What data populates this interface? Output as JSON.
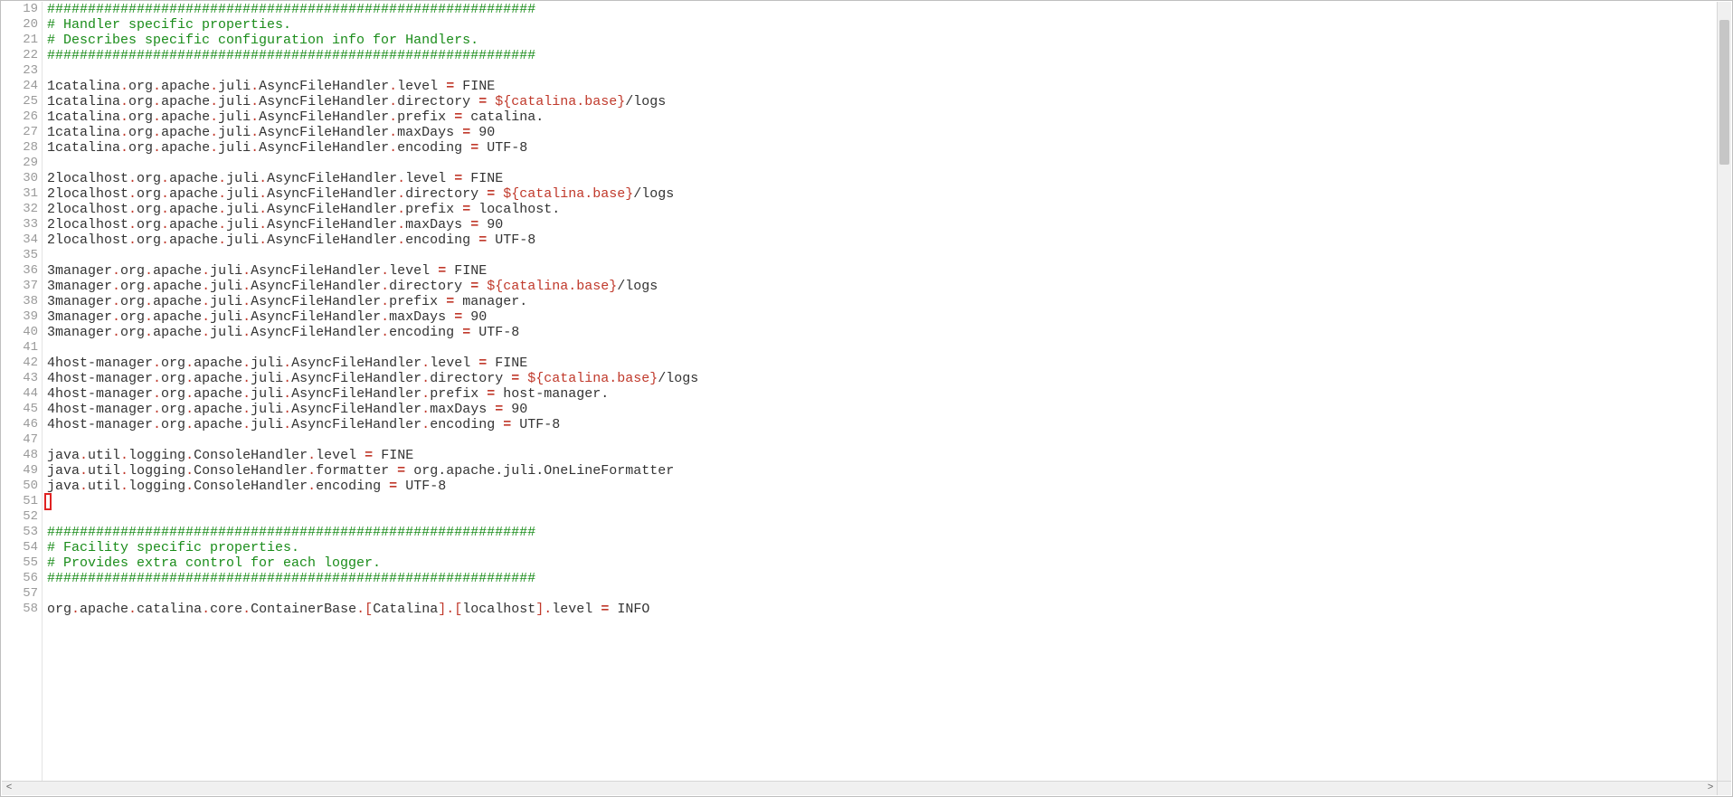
{
  "editor": {
    "first_line_number": 19,
    "line_height": 17,
    "highlighted_line": 51,
    "lines": [
      {
        "type": "comment",
        "text": "############################################################"
      },
      {
        "type": "comment",
        "text": "# Handler specific properties."
      },
      {
        "type": "comment",
        "text": "# Describes specific configuration info for Handlers."
      },
      {
        "type": "comment",
        "text": "############################################################"
      },
      {
        "type": "blank"
      },
      {
        "type": "prop",
        "key": "1catalina.org.apache.juli.AsyncFileHandler.level",
        "value": "FINE"
      },
      {
        "type": "prop",
        "key": "1catalina.org.apache.juli.AsyncFileHandler.directory",
        "value": "${catalina.base}/logs",
        "has_var": true
      },
      {
        "type": "prop",
        "key": "1catalina.org.apache.juli.AsyncFileHandler.prefix",
        "value": "catalina."
      },
      {
        "type": "prop",
        "key": "1catalina.org.apache.juli.AsyncFileHandler.maxDays",
        "value": "90"
      },
      {
        "type": "prop",
        "key": "1catalina.org.apache.juli.AsyncFileHandler.encoding",
        "value": "UTF-8"
      },
      {
        "type": "blank"
      },
      {
        "type": "prop",
        "key": "2localhost.org.apache.juli.AsyncFileHandler.level",
        "value": "FINE"
      },
      {
        "type": "prop",
        "key": "2localhost.org.apache.juli.AsyncFileHandler.directory",
        "value": "${catalina.base}/logs",
        "has_var": true
      },
      {
        "type": "prop",
        "key": "2localhost.org.apache.juli.AsyncFileHandler.prefix",
        "value": "localhost."
      },
      {
        "type": "prop",
        "key": "2localhost.org.apache.juli.AsyncFileHandler.maxDays",
        "value": "90"
      },
      {
        "type": "prop",
        "key": "2localhost.org.apache.juli.AsyncFileHandler.encoding",
        "value": "UTF-8"
      },
      {
        "type": "blank"
      },
      {
        "type": "prop",
        "key": "3manager.org.apache.juli.AsyncFileHandler.level",
        "value": "FINE"
      },
      {
        "type": "prop",
        "key": "3manager.org.apache.juli.AsyncFileHandler.directory",
        "value": "${catalina.base}/logs",
        "has_var": true
      },
      {
        "type": "prop",
        "key": "3manager.org.apache.juli.AsyncFileHandler.prefix",
        "value": "manager."
      },
      {
        "type": "prop",
        "key": "3manager.org.apache.juli.AsyncFileHandler.maxDays",
        "value": "90"
      },
      {
        "type": "prop",
        "key": "3manager.org.apache.juli.AsyncFileHandler.encoding",
        "value": "UTF-8"
      },
      {
        "type": "blank"
      },
      {
        "type": "prop",
        "key": "4host-manager.org.apache.juli.AsyncFileHandler.level",
        "value": "FINE"
      },
      {
        "type": "prop",
        "key": "4host-manager.org.apache.juli.AsyncFileHandler.directory",
        "value": "${catalina.base}/logs",
        "has_var": true
      },
      {
        "type": "prop",
        "key": "4host-manager.org.apache.juli.AsyncFileHandler.prefix",
        "value": "host-manager."
      },
      {
        "type": "prop",
        "key": "4host-manager.org.apache.juli.AsyncFileHandler.maxDays",
        "value": "90"
      },
      {
        "type": "prop",
        "key": "4host-manager.org.apache.juli.AsyncFileHandler.encoding",
        "value": "UTF-8"
      },
      {
        "type": "blank"
      },
      {
        "type": "prop",
        "key": "java.util.logging.ConsoleHandler.level",
        "value": "FINE"
      },
      {
        "type": "prop",
        "key": "java.util.logging.ConsoleHandler.formatter",
        "value": "org.apache.juli.OneLineFormatter"
      },
      {
        "type": "prop",
        "key": "java.util.logging.ConsoleHandler.encoding",
        "value": "UTF-8"
      },
      {
        "type": "blank"
      },
      {
        "type": "blank"
      },
      {
        "type": "comment",
        "text": "############################################################"
      },
      {
        "type": "comment",
        "text": "# Facility specific properties."
      },
      {
        "type": "comment",
        "text": "# Provides extra control for each logger."
      },
      {
        "type": "comment",
        "text": "############################################################"
      },
      {
        "type": "blank"
      },
      {
        "type": "prop",
        "key": "org.apache.catalina.core.ContainerBase.[Catalina].[localhost].level",
        "value": "INFO"
      }
    ]
  },
  "scroll": {
    "arrow_left": "<",
    "arrow_right": ">"
  }
}
